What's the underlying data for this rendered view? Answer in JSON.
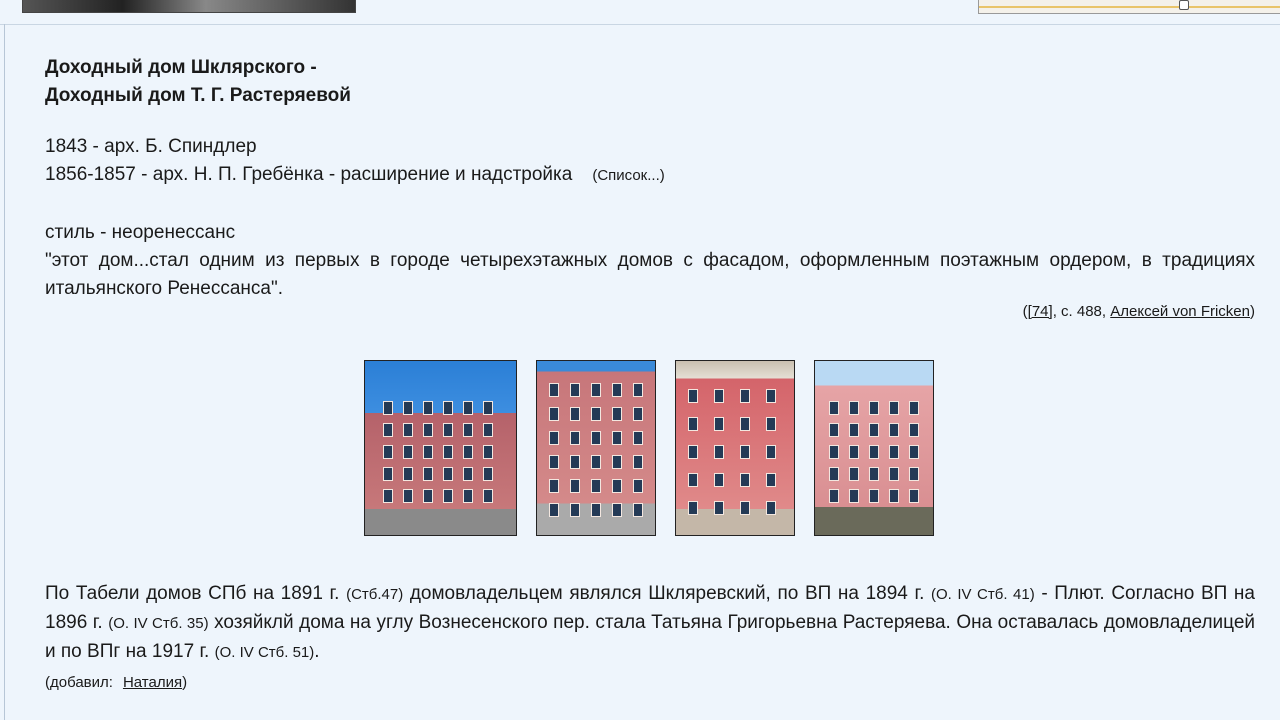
{
  "header": {
    "top_photo_icon": "photo-strip-icon",
    "map_icon": "map-thumbnail-icon"
  },
  "main": {
    "title_line1": "Доходный дом Шклярского -",
    "title_line2": "Доходный дом Т. Г. Растеряевой",
    "arch1": "1843 - арх. Б. Спиндлер",
    "arch2": "1856-1857 - арх. Н. П. Гребёнка - расширение и надстройка",
    "list_link": "(Список...)",
    "style": "стиль - неоренессанс",
    "quote": "\"этот дом...стал одним из первых в городе четырехэтажных домов с фасадом, оформленным поэтажным ордером, в традициях итальянского Ренессанса\".",
    "ref_open": "(",
    "ref_source": "[74]",
    "ref_page": ", с. 488, ",
    "ref_author": "Алексей von Fricken",
    "ref_close": ")"
  },
  "gallery": {
    "photos": [
      {
        "alt": "Фасад 1"
      },
      {
        "alt": "Фасад 2"
      },
      {
        "alt": "Фасад 3"
      },
      {
        "alt": "Фасад 4"
      }
    ]
  },
  "history": {
    "t1": "По Табели домов СПб на 1891 г. ",
    "s1": "(Стб.47)",
    "t2": " домовладельцем являлся Шкляревский, по ВП на 1894 г. ",
    "s2": "(О. IV Стб. 41)",
    "t3": " - Плют. Согласно ВП на 1896 г. ",
    "s3": "(О. IV Стб. 35)",
    "t4": " хозяйклй дома на углу Вознесенского пер. стала Татьяна Григорьевна Растеряева. Она оставалась домовладелицей и по ВПг на 1917 г. ",
    "s4": "(О. IV Стб. 51)",
    "t5": ".",
    "added_label": "(добавил:",
    "added_user": "Наталия",
    "added_close": ")"
  },
  "colors": {
    "background": "#eef5fc",
    "text": "#1a1a1a"
  }
}
